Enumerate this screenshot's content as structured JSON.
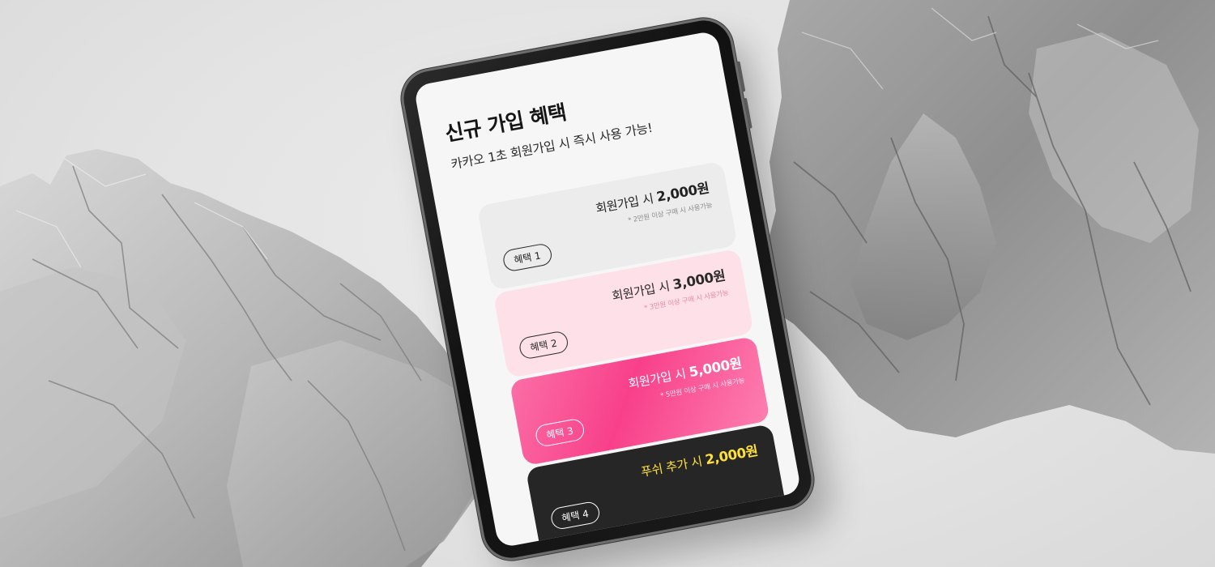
{
  "screen": {
    "title": "신규 가입 혜택",
    "subtitle": "카카오 1초 회원가입 시 즉시 사용 가능!",
    "cards": [
      {
        "badge": "혜택 1",
        "amount_prefix": "회원가입 시 ",
        "amount_value": "2,000원",
        "note": "* 2만원 이상 구매 시 사용가능"
      },
      {
        "badge": "혜택 2",
        "amount_prefix": "회원가입 시 ",
        "amount_value": "3,000원",
        "note": "* 3만원 이상 구매 시 사용가능"
      },
      {
        "badge": "혜택 3",
        "amount_prefix": "회원가입 시 ",
        "amount_value": "5,000원",
        "note": "* 5만원 이상 구매 시 사용가능"
      },
      {
        "badge": "혜택 4",
        "amount_prefix": "푸쉬 추가 시 ",
        "amount_value": "2,000원"
      }
    ]
  },
  "colors": {
    "background": "#e3e3e3",
    "screen_bg": "#f6f6f6",
    "card1_bg": "#ececec",
    "card2_bg": "#fde0e8",
    "card3_bg": "#f8408a",
    "card4_bg": "#262626",
    "card4_text": "#ffe13a"
  }
}
